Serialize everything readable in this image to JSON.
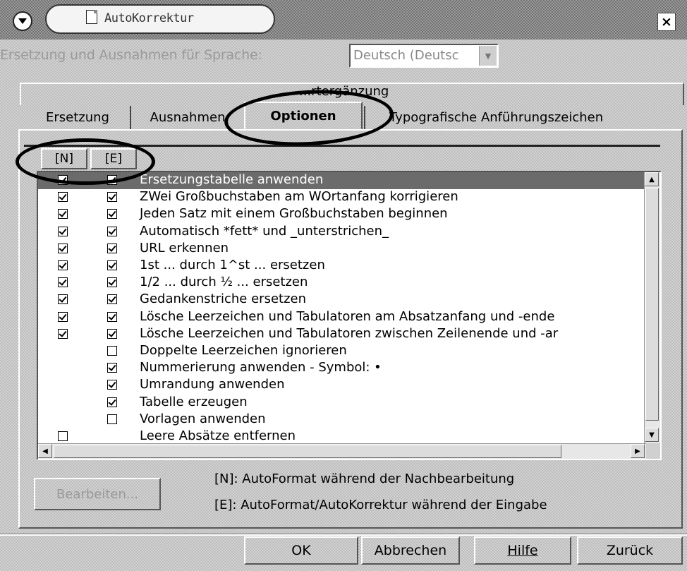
{
  "window": {
    "title": "AutoKorrektur",
    "close_glyph": "×"
  },
  "language": {
    "label": "Ersetzung und Ausnahmen für Sprache:",
    "value": "Deutsch (Deutsc"
  },
  "tabs": {
    "row1": [
      "Wortergänzung"
    ],
    "row1_visible": "...rtergänzung",
    "row2": [
      {
        "label": "Ersetzung"
      },
      {
        "label": "Ausnahmen"
      },
      {
        "label": "Optionen",
        "active": true
      },
      {
        "label": "Typografische Anführungszeichen"
      }
    ]
  },
  "list": {
    "columns": [
      "[N]",
      "[E]"
    ],
    "rows": [
      {
        "label": "Ersetzungstabelle anwenden",
        "n": true,
        "e": true,
        "selected": true
      },
      {
        "label": "ZWei Großbuchstaben am WOrtanfang korrigieren",
        "n": true,
        "e": true
      },
      {
        "label": "Jeden Satz mit einem Großbuchstaben beginnen",
        "n": true,
        "e": true
      },
      {
        "label": "Automatisch *fett* und _unterstrichen_",
        "n": true,
        "e": true
      },
      {
        "label": "URL erkennen",
        "n": true,
        "e": true
      },
      {
        "label": "1st ... durch 1^st ... ersetzen",
        "n": true,
        "e": true
      },
      {
        "label": "1/2 ... durch ½ ... ersetzen",
        "n": true,
        "e": true
      },
      {
        "label": "Gedankenstriche ersetzen",
        "n": true,
        "e": true
      },
      {
        "label": "Lösche Leerzeichen und Tabulatoren am Absatzanfang und -ende",
        "n": true,
        "e": true
      },
      {
        "label": "Lösche Leerzeichen und Tabulatoren zwischen Zeilenende und -ar",
        "n": true,
        "e": true
      },
      {
        "label": "Doppelte Leerzeichen ignorieren",
        "n": null,
        "e": false
      },
      {
        "label": "Nummerierung anwenden - Symbol: •",
        "n": null,
        "e": true
      },
      {
        "label": "Umrandung anwenden",
        "n": null,
        "e": true
      },
      {
        "label": "Tabelle erzeugen",
        "n": null,
        "e": true
      },
      {
        "label": "Vorlagen anwenden",
        "n": null,
        "e": false
      },
      {
        "label": "Leere Absätze entfernen",
        "n": false,
        "e": null
      }
    ]
  },
  "edit_button": "Bearbeiten...",
  "legend": {
    "n": "[N]: AutoFormat während der Nachbearbeitung",
    "e": "[E]: AutoFormat/AutoKorrektur während der Eingabe"
  },
  "footer": {
    "ok": "OK",
    "cancel": "Abbrechen",
    "help": "Hilfe",
    "back": "Zurück"
  },
  "icons": [
    "window-menu-icon",
    "document-icon",
    "close-icon",
    "dropdown-arrow-icon",
    "scroll-up-icon",
    "scroll-down-icon",
    "scroll-left-icon",
    "scroll-right-icon"
  ]
}
